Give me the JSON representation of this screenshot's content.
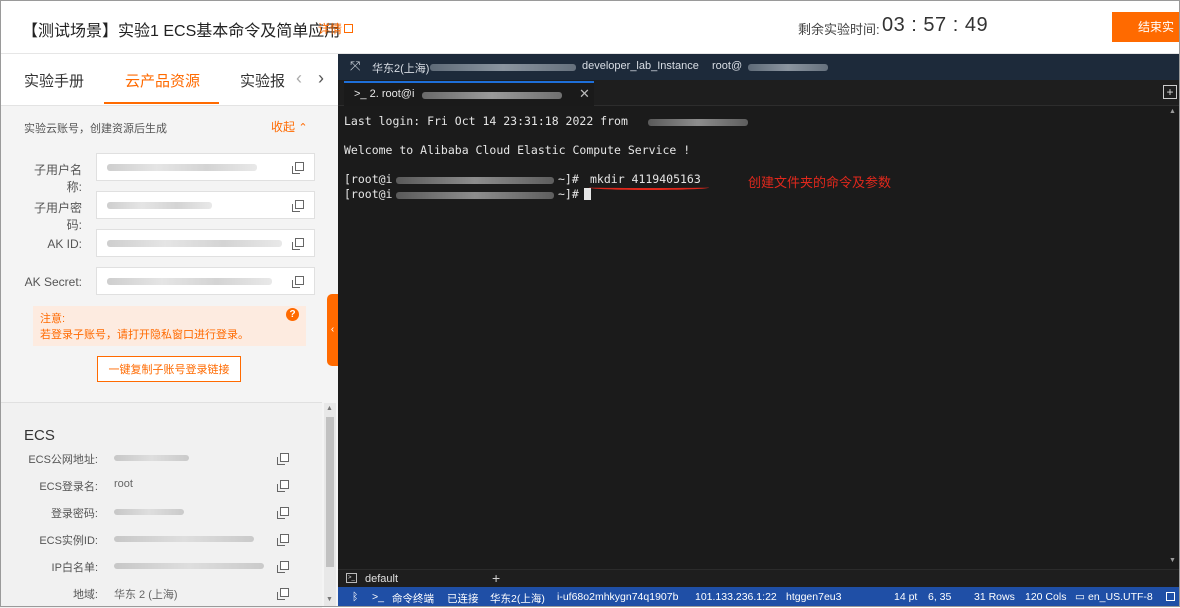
{
  "header": {
    "title": "【测试场景】实验1 ECS基本命令及简单应用",
    "detail_label": "详情",
    "timer_label": "剩余实验时间:",
    "timer_value": "03 : 57 : 49",
    "end_button": "结束实"
  },
  "left_panel": {
    "tabs": [
      "实验手册",
      "云产品资源",
      "实验报"
    ],
    "active_tab": "云产品资源",
    "account": {
      "description": "实验云账号，创建资源后生成",
      "collapse_label": "收起",
      "fields": [
        {
          "label": "子用户名称:"
        },
        {
          "label": "子用户密码:"
        },
        {
          "label": "AK ID:"
        },
        {
          "label": "AK Secret:"
        }
      ],
      "notice_title": "注意:",
      "notice_text": "若登录子账号，请打开隐私窗口进行登录。",
      "copy_link_button": "一键复制子账号登录链接"
    },
    "ecs": {
      "title": "ECS",
      "fields": [
        {
          "label": "ECS公网地址:",
          "value": ""
        },
        {
          "label": "ECS登录名:",
          "value": "root"
        },
        {
          "label": "登录密码:",
          "value": ""
        },
        {
          "label": "ECS实例ID:",
          "value": ""
        },
        {
          "label": "IP白名单:",
          "value": ""
        },
        {
          "label": "地域:",
          "value": "华东 2 (上海)"
        }
      ]
    }
  },
  "terminal": {
    "top_bar": {
      "region": "华东2(上海)",
      "instance_name": "developer_lab_Instance",
      "user": "root@"
    },
    "tab_label": "2. root@i",
    "lines": {
      "last_login": "Last login: Fri Oct 14 23:31:18 2022 from",
      "welcome": "Welcome to Alibaba Cloud Elastic Compute Service !",
      "prompt_open": "[root@i",
      "prompt_close": "~]#",
      "command": "mkdir 4119405163"
    },
    "annotation": "创建文件夹的命令及参数",
    "session_name": "default",
    "status": {
      "cmd_terminal": "命令终端",
      "connected": "已连接",
      "region": "华东2(上海)",
      "instance_id": "i-uf68o2mhkygn74q1907b",
      "address": "101.133.236.1:22",
      "host": "htggen7eu3",
      "font_size": "14 pt",
      "cursor_pos": "6, 35",
      "rows": "31 Rows",
      "cols": "120 Cols",
      "encoding": "en_US.UTF-8"
    }
  },
  "colors": {
    "accent": "#ff6a00",
    "terminal_bg": "#1b1b1b",
    "status_bar": "#1f4fa6",
    "annotation": "#e0281c"
  }
}
